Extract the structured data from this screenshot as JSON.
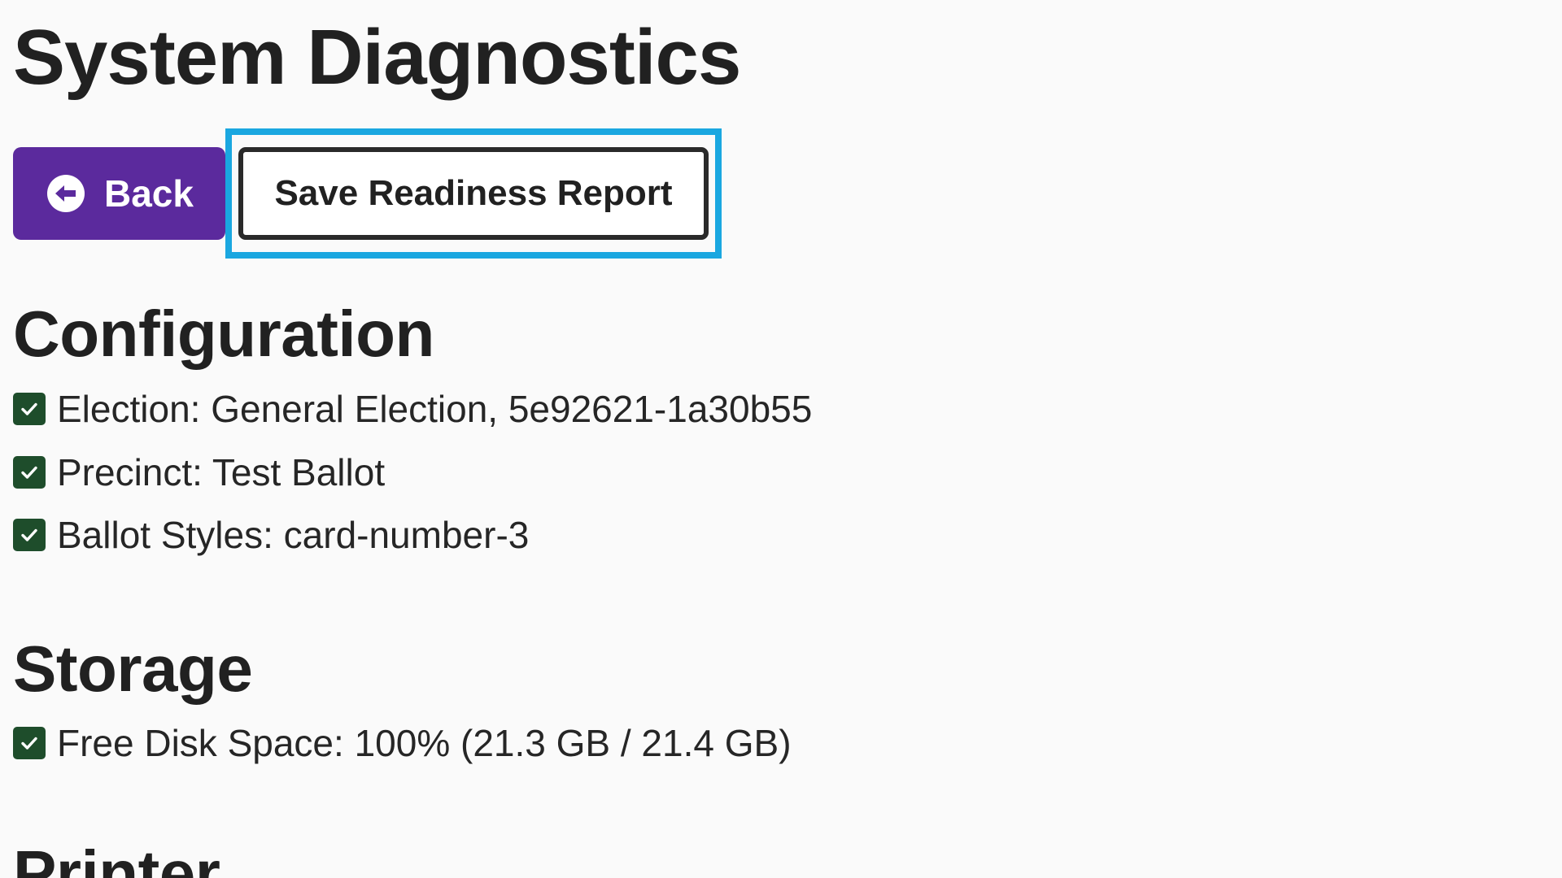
{
  "header": {
    "title": "System Diagnostics"
  },
  "toolbar": {
    "back_label": "Back",
    "save_label": "Save Readiness Report"
  },
  "sections": [
    {
      "title": "Configuration",
      "items": [
        {
          "label": "Election: General Election, 5e92621-1a30b55",
          "status": "pass"
        },
        {
          "label": "Precinct: Test Ballot",
          "status": "pass"
        },
        {
          "label": "Ballot Styles: card-number-3",
          "status": "pass"
        }
      ]
    },
    {
      "title": "Storage",
      "items": [
        {
          "label": "Free Disk Space: 100% (21.3 GB / 21.4 GB)",
          "status": "pass"
        }
      ]
    },
    {
      "title": "Printer",
      "items": []
    }
  ],
  "colors": {
    "primary": "#5b2a9d",
    "focus_ring": "#1aa7e0",
    "success_check": "#1e4d2b",
    "background": "#fafafa",
    "text": "#212121"
  },
  "icons": {
    "back": "circle-arrow-left-icon",
    "check": "checkbox-checked-icon"
  }
}
